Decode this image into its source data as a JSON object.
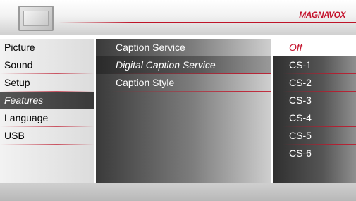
{
  "header": {
    "brand": "MAGNAVOX",
    "icon": "tv-icon"
  },
  "main_menu": {
    "items": [
      {
        "label": "Picture"
      },
      {
        "label": "Sound"
      },
      {
        "label": "Setup"
      },
      {
        "label": "Features"
      },
      {
        "label": "Language"
      },
      {
        "label": "USB"
      }
    ],
    "selected": "Features"
  },
  "features_menu": {
    "items": [
      {
        "label": "Caption Service"
      },
      {
        "label": "Digital Caption Service"
      },
      {
        "label": "Caption Style"
      }
    ],
    "selected": "Digital Caption Service"
  },
  "caption_options": {
    "items": [
      {
        "label": "Off"
      },
      {
        "label": "CS-1"
      },
      {
        "label": "CS-2"
      },
      {
        "label": "CS-3"
      },
      {
        "label": "CS-4"
      },
      {
        "label": "CS-5"
      },
      {
        "label": "CS-6"
      }
    ],
    "selected": "Off"
  },
  "colors": {
    "accent": "#c4122c",
    "selected_text_right": "#c4122c"
  }
}
